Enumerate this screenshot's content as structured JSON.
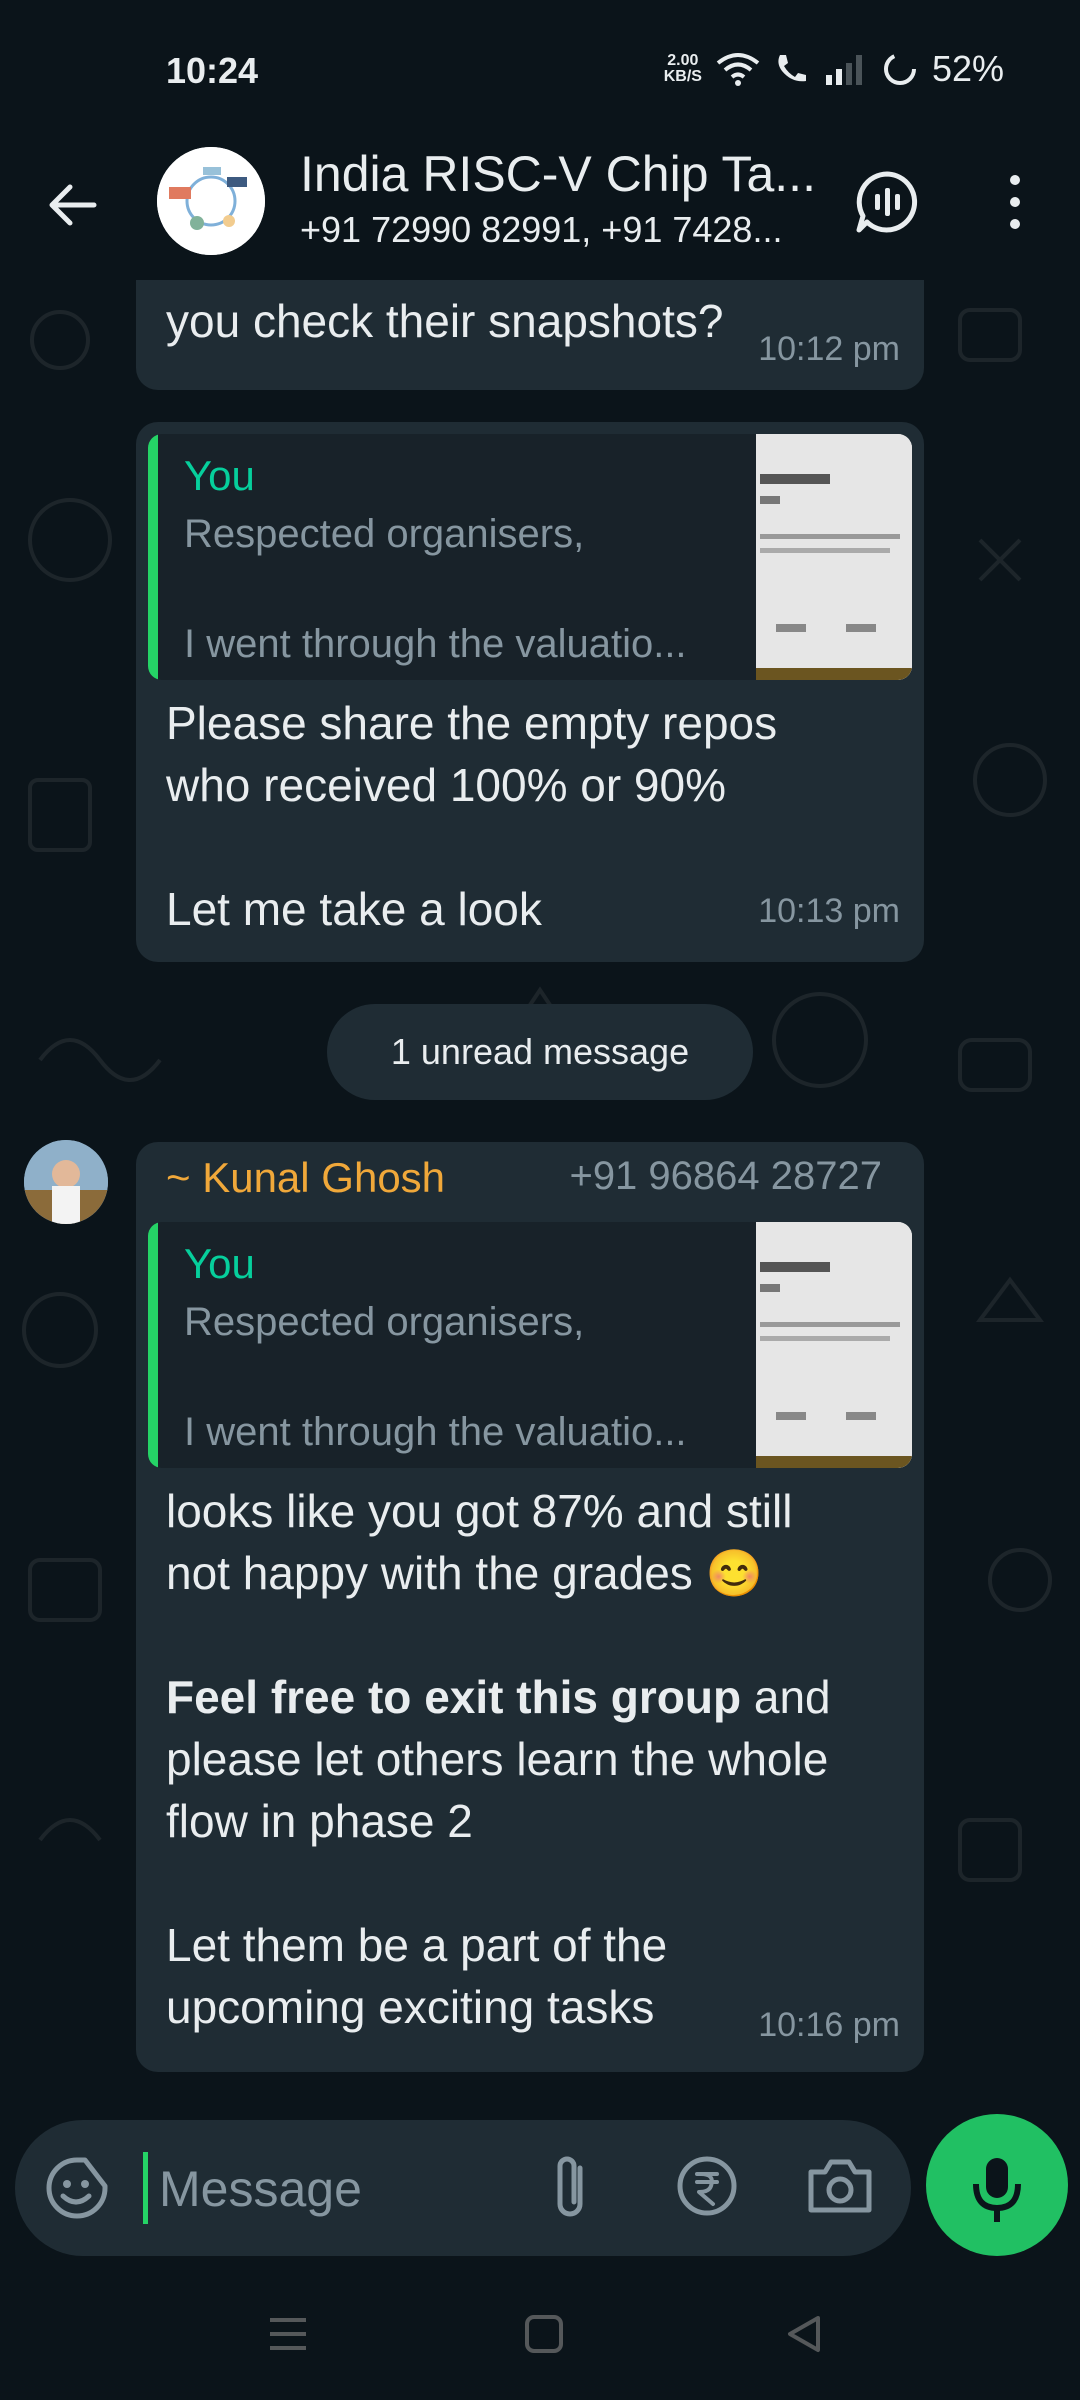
{
  "status": {
    "time": "10:24",
    "speed_value": "2.00",
    "speed_unit": "KB/S",
    "battery": "52%"
  },
  "header": {
    "title": "India RISC-V Chip Ta...",
    "subtitle": "+91 72990 82991, +91 7428..."
  },
  "messages": {
    "m1": {
      "text": "you check their snapshots?",
      "time": "10:12 pm"
    },
    "m2": {
      "quote_author": "You",
      "quote_line1": "Respected organisers,",
      "quote_line2": "I went through the valuatio...",
      "line1": "Please share the empty repos",
      "line2": "who received 100% or 90%",
      "line3": "Let me take a look",
      "time": "10:13 pm"
    },
    "unread": "1 unread message",
    "m3": {
      "sender_name": "~ Kunal Ghosh",
      "sender_phone": "+91 96864 28727",
      "quote_author": "You",
      "quote_line1": "Respected organisers,",
      "quote_line2": "I went through the valuatio...",
      "p1_line1": "looks like you got 87% and still",
      "p1_line2": "not happy with the grades",
      "emoji": "😊",
      "p2_bold": "Feel free to exit this group",
      "p2_rest": " and",
      "p2_line2": "please let others learn the whole",
      "p2_line3": "flow in phase 2",
      "p3_line1": "Let them be a part of the",
      "p3_line2": "upcoming exciting tasks",
      "time": "10:16 pm"
    }
  },
  "compose": {
    "placeholder": "Message"
  },
  "colors": {
    "background": "#0b141a",
    "bubble": "#1f2c34",
    "accent_green": "#21c063",
    "sender_name": "#f0a83a",
    "quote_author": "#06cf9c"
  }
}
